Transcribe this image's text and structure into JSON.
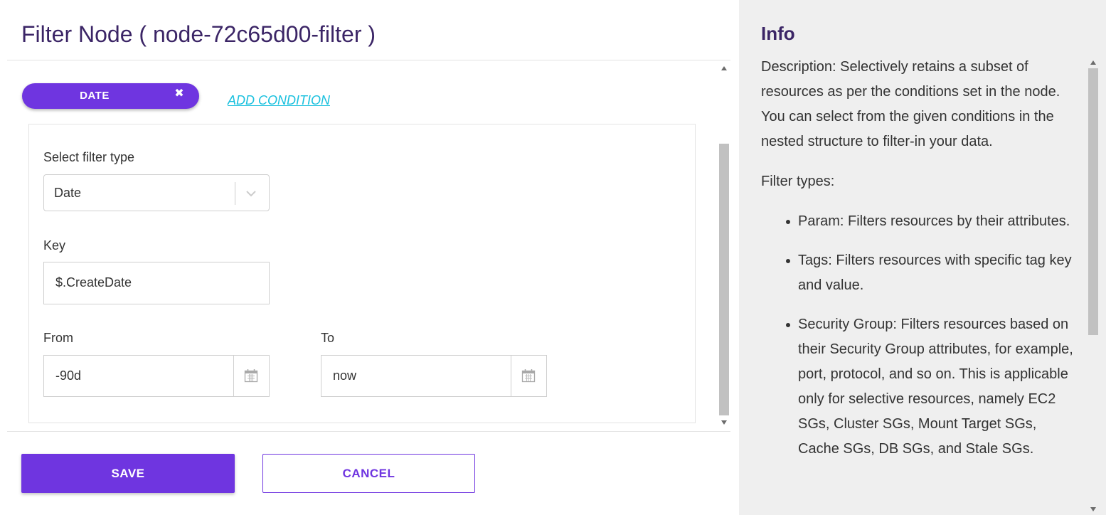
{
  "header": {
    "title": "Filter Node ( node-72c65d00-filter )"
  },
  "condition_chip": {
    "label": "DATE",
    "close_glyph": "✖"
  },
  "add_condition": {
    "label": "ADD CONDITION"
  },
  "form": {
    "filter_type": {
      "label": "Select filter type",
      "value": "Date"
    },
    "key": {
      "label": "Key",
      "value": "$.CreateDate"
    },
    "from": {
      "label": "From",
      "value": "-90d"
    },
    "to": {
      "label": "To",
      "value": "now"
    }
  },
  "actions": {
    "save_label": "SAVE",
    "cancel_label": "CANCEL"
  },
  "info": {
    "title": "Info",
    "description": "Description: Selectively retains a subset of resources as per the conditions set in the node. You can select from the given conditions in the nested structure to filter-in your data.",
    "filter_types_heading": "Filter types:",
    "filter_types": [
      "Param: Filters resources by their attributes.",
      "Tags: Filters resources with specific tag key and value.",
      "Security Group: Filters resources based on their Security Group attributes, for example, port, protocol, and so on. This is applicable only for selective resources, namely EC2 SGs, Cluster SGs, Mount Target SGs, Cache SGs, DB SGs, and Stale SGs."
    ]
  },
  "icons": {
    "chip_close": "close-icon",
    "select_caret": "chevron-down-icon",
    "from_calendar": "calendar-icon",
    "to_calendar": "calendar-icon"
  },
  "colors": {
    "brand": "#6f35e0",
    "link": "#19c0de",
    "title": "#3b2566",
    "info_bg": "#efefef"
  }
}
